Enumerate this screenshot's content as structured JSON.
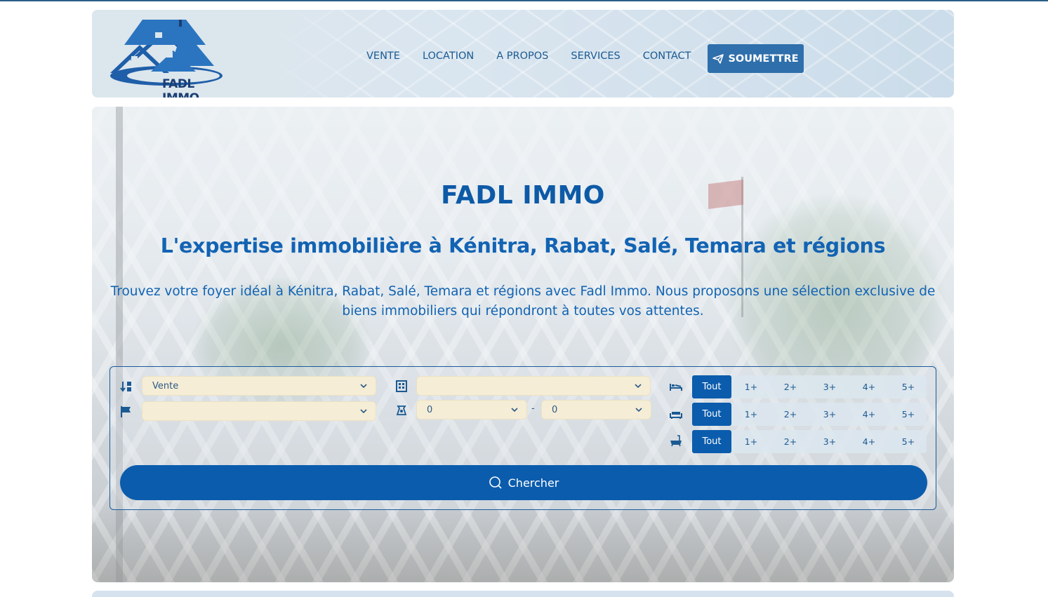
{
  "brand": {
    "name": "FADL IMMO"
  },
  "nav": {
    "items": [
      "VENTE",
      "LOCATION",
      "A PROPOS",
      "SERVICES",
      "CONTACT"
    ],
    "submit_label": "SOUMETTRE"
  },
  "hero": {
    "title": "FADL IMMO",
    "subtitle": "L'expertise immobilière à Kénitra, Rabat, Salé, Temara et régions",
    "description": "Trouvez votre foyer idéal à Kénitra, Rabat, Salé, Temara et régions avec Fadl Immo. Nous proposons une sélection exclusive de biens immobiliers qui répondront à toutes vos attentes."
  },
  "search": {
    "transaction": {
      "selected": "Vente",
      "icon": "transaction-icon"
    },
    "property_type": {
      "selected": "",
      "icon": "building-icon"
    },
    "city": {
      "selected": "",
      "icon": "city-icon"
    },
    "price": {
      "min": "0",
      "max": "0",
      "separator": "-",
      "icon": "price-icon"
    },
    "bedrooms": {
      "options": [
        "Tout",
        "1+",
        "2+",
        "3+",
        "4+",
        "5+"
      ],
      "selected": "Tout",
      "icon": "bed-icon"
    },
    "living_rooms": {
      "options": [
        "Tout",
        "1+",
        "2+",
        "3+",
        "4+",
        "5+"
      ],
      "selected": "Tout",
      "icon": "sofa-icon"
    },
    "bathrooms": {
      "options": [
        "Tout",
        "1+",
        "2+",
        "3+",
        "4+",
        "5+"
      ],
      "selected": "Tout",
      "icon": "bath-icon"
    },
    "submit_label": "Chercher"
  },
  "colors": {
    "primary": "#0b5cad",
    "select_bg": "#f5edd6",
    "header_bg": "#dce6ed",
    "submit_bg": "#2f6fab"
  }
}
